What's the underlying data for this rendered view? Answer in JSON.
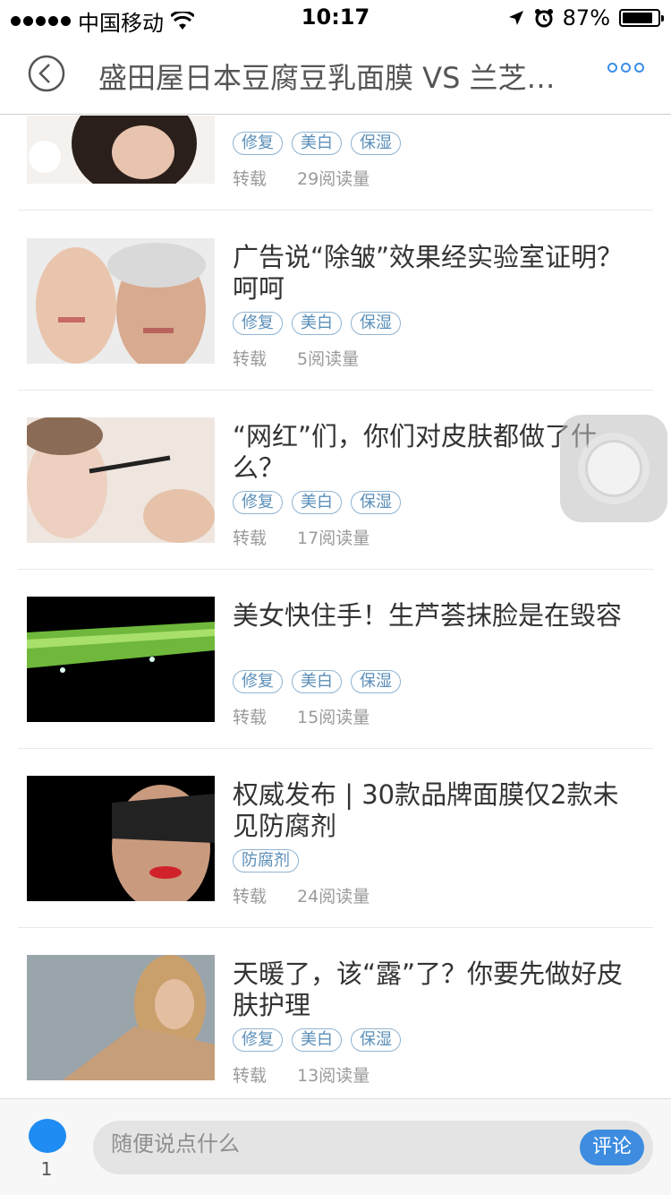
{
  "status_bar": {
    "carrier": "中国移动",
    "time": "10:17",
    "battery_percent": "87%",
    "battery_level": 0.87
  },
  "nav": {
    "title": "盛田屋日本豆腐豆乳面膜 VS 兰芝…",
    "back_icon": "chevron-left-circle-icon",
    "more_icon": "more-dots-icon"
  },
  "articles": [
    {
      "title": "",
      "tags": [
        "修复",
        "美白",
        "保湿"
      ],
      "source": "转载",
      "views": "29阅读量"
    },
    {
      "title": "广告说“除皱”效果经实验室证明？呵呵",
      "tags": [
        "修复",
        "美白",
        "保湿"
      ],
      "source": "转载",
      "views": "5阅读量"
    },
    {
      "title": "“网红”们，你们对皮肤都做了什么？",
      "tags": [
        "修复",
        "美白",
        "保湿"
      ],
      "source": "转载",
      "views": "17阅读量"
    },
    {
      "title": "美女快住手！生芦荟抹脸是在毁容",
      "tags": [
        "修复",
        "美白",
        "保湿"
      ],
      "source": "转载",
      "views": "15阅读量"
    },
    {
      "title": "权威发布 | 30款品牌面膜仅2款未见防腐剂",
      "tags": [
        "防腐剂"
      ],
      "source": "转载",
      "views": "24阅读量"
    },
    {
      "title": "天暖了，该“露”了？你要先做好皮肤护理",
      "tags": [
        "修复",
        "美白",
        "保湿"
      ],
      "source": "转载",
      "views": "13阅读量"
    }
  ],
  "bottom_bar": {
    "count": "1",
    "comment_placeholder": "随便说点什么",
    "comment_button": "评论"
  },
  "colors": {
    "accent": "#3d8ce0",
    "tag_text": "#5b8fb9",
    "meta_text": "#9a9a9a"
  }
}
